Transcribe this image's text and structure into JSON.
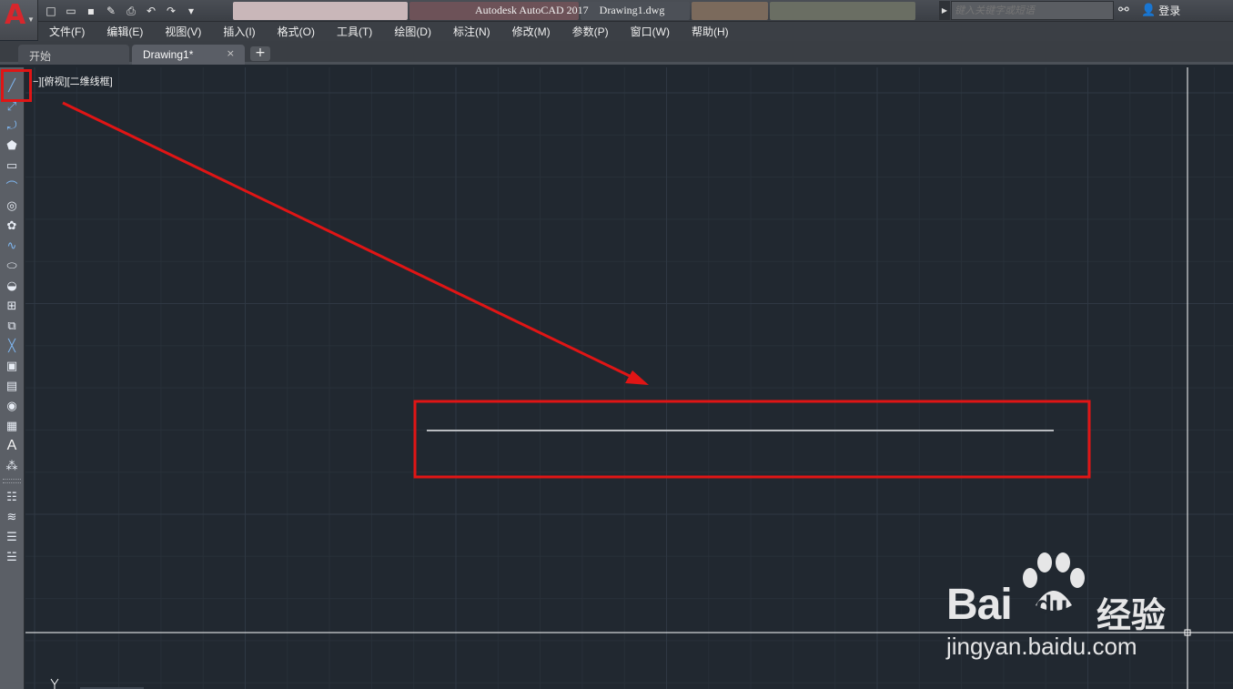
{
  "app": {
    "logo_letter": "A",
    "window_title": "Autodesk AutoCAD 2017    Drawing1.dwg"
  },
  "quick_access": {
    "icons": [
      "new-icon",
      "open-icon",
      "save-icon",
      "save-as-icon",
      "plot-icon",
      "undo-icon",
      "redo-icon",
      "customize-icon"
    ]
  },
  "search": {
    "placeholder": "键入关键字或短语"
  },
  "account": {
    "login_label": "登录"
  },
  "menu": {
    "items": [
      "文件(F)",
      "编辑(E)",
      "视图(V)",
      "插入(I)",
      "格式(O)",
      "工具(T)",
      "绘图(D)",
      "标注(N)",
      "修改(M)",
      "参数(P)",
      "窗口(W)",
      "帮助(H)"
    ]
  },
  "tabs": {
    "start": "开始",
    "active": "Drawing1*",
    "close": "×",
    "add": "+"
  },
  "viewport": {
    "label": "−][俯视][二维线框]"
  },
  "draw_toolbar": {
    "tools": [
      "line",
      "construction-line",
      "polyline",
      "polygon",
      "rectangle",
      "arc",
      "circle",
      "revision-cloud",
      "spline",
      "ellipse",
      "ellipse-arc",
      "insert-block",
      "make-block",
      "point",
      "hatch",
      "gradient",
      "region",
      "table",
      "multiline-text",
      "add-selected"
    ],
    "text_tool_glyph": "A"
  },
  "annotation": {
    "highlight_color": "#e01515",
    "arrow_color": "#e01515"
  },
  "watermark": {
    "brand": "Bai",
    "brand_suffix": "du",
    "product": "经验",
    "url": "jingyan.baidu.com"
  },
  "colors": {
    "canvas_bg": "#212830",
    "grid_minor": "#283039",
    "grid_major": "#2f3843",
    "drawn_line": "#b9bcc0",
    "crosshair": "#ffffff"
  }
}
